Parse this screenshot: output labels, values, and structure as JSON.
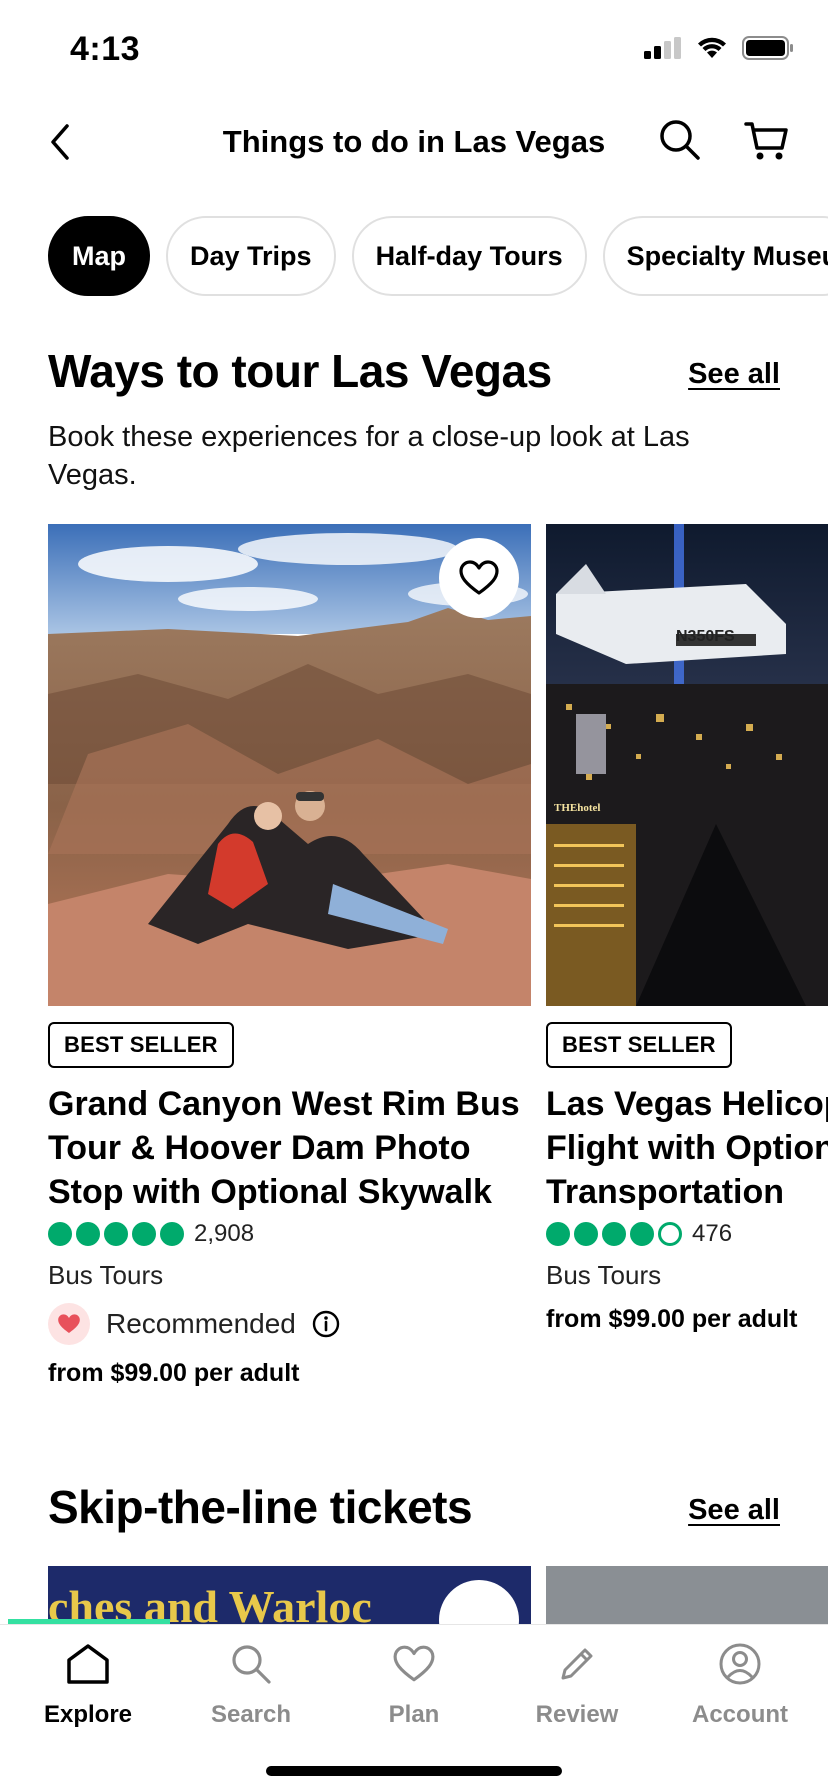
{
  "status_bar": {
    "time": "4:13"
  },
  "nav": {
    "title": "Things to do in Las Vegas"
  },
  "chips": [
    {
      "label": "Map",
      "active": true
    },
    {
      "label": "Day Trips",
      "active": false
    },
    {
      "label": "Half-day Tours",
      "active": false
    },
    {
      "label": "Specialty Museu",
      "active": false
    }
  ],
  "section_1": {
    "title": "Ways to tour Las Vegas",
    "see_all": "See all",
    "subtitle": "Book these experiences for a close-up look at Las Vegas.",
    "cards": [
      {
        "badge": "BEST SELLER",
        "title": "Grand Canyon West Rim Bus\nTour & Hoover Dam Photo\nStop with Optional Skywalk",
        "rating": 5,
        "rating_count": "2,908",
        "category": "Bus Tours",
        "recommended": "Recommended",
        "price": "from $99.00 per adult"
      },
      {
        "badge": "BEST SELLER",
        "title": "Las Vegas Helicop\nFlight with Option\nTransportation",
        "rating": 4,
        "rating_count": "476",
        "category": "Bus Tours",
        "price": "from $99.00 per adult",
        "image_text": "N350FS",
        "image_text_2": "THEhotel"
      }
    ]
  },
  "section_2": {
    "title": "Skip-the-line tickets",
    "see_all": "See all",
    "image_text": "ches and Warloc"
  },
  "tab_bar": {
    "tabs": [
      {
        "label": "Explore",
        "icon": "home-icon",
        "active": true
      },
      {
        "label": "Search",
        "icon": "search-icon",
        "active": false
      },
      {
        "label": "Plan",
        "icon": "heart-icon",
        "active": false
      },
      {
        "label": "Review",
        "icon": "pencil-icon",
        "active": false
      },
      {
        "label": "Account",
        "icon": "account-icon",
        "active": false
      }
    ]
  },
  "colors": {
    "rating_green": "#00aa6c",
    "tab_indicator": "#34e0a1",
    "chip_active": "#000000"
  }
}
